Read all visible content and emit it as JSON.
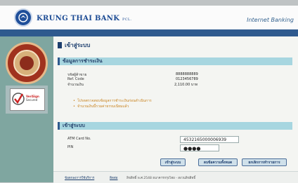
{
  "brand": {
    "name": "KRUNG THAI BANK",
    "suffix": "PCL.",
    "service": "Internet Banking"
  },
  "page": {
    "title": "เข้าสู่ระบบ"
  },
  "payment": {
    "heading": "ข้อมูลการชำระเงิน",
    "rows": [
      {
        "label": "รหัสผู้ค้าขาย",
        "value": "8888888889"
      },
      {
        "label": "Ref. Code",
        "value": "0123456789"
      },
      {
        "label": "จำนวนเงิน",
        "value": "2,110.00 บาท"
      }
    ],
    "notes": [
      "โปรดตรวจสอบข้อมูลการชำระเงินก่อนดำเนินการ",
      "จำนวนเงินนี้รวมค่าธรรมเนียมแล้ว"
    ]
  },
  "login": {
    "heading": "เข้าสู่ระบบ",
    "atm_label": "ATM Card No.",
    "atm_value": "4532165000006939",
    "pin_label": "PIN",
    "pin_value": "●●●●"
  },
  "buttons": {
    "login": "เข้าสู่ระบบ",
    "clear": "ลบข้อความทั้งหมด",
    "cancel": "ยกเลิกการทำรายการ"
  },
  "footer": {
    "link1": "ข้อตกลงการใช้บริการ",
    "link2": "ติดต่อ",
    "text": "ลิขสิทธิ์ พ.ศ.2548 ธนาคารกรุงไทย - สงวนลิขสิทธิ์"
  },
  "verisign": {
    "line1": "VeriSign",
    "line2": "Secured"
  },
  "colors": {
    "header_band": "#2f5a8e",
    "subhead_bg": "#a7d6e0",
    "sidebar": "#7fa6a0",
    "note": "#c8811c"
  }
}
